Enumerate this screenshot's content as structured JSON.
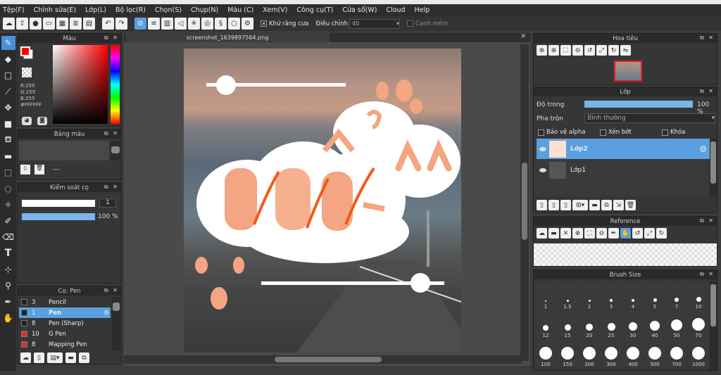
{
  "menu": [
    "Tệp(F)",
    "Chỉnh sửa(E)",
    "Lớp(L)",
    "Bộ lọc(R)",
    "Chọn(S)",
    "Chụp(N)",
    "Màu (C)",
    "Xem(V)",
    "Công cụ(T)",
    "Cửa sổ(W)",
    "Cloud",
    "Help"
  ],
  "toolbar": {
    "antialias_label": "Khử răng cưa",
    "adjust_label": "Điều chỉnh",
    "adjust_value": "40",
    "soft_edge_label": "Cạnh mềm"
  },
  "color_panel": {
    "title": "Màu",
    "r": "R:255",
    "g": "G:255",
    "b": "B:255",
    "hex": "#FFFFFF",
    "fg": "#ff0000",
    "bg": "#ffffff"
  },
  "palette_panel": {
    "title": "Bảng màu",
    "dash": "---"
  },
  "control_panel": {
    "title": "Kiểm soát cọ",
    "size": "1",
    "opacity": "100 %"
  },
  "brush_panel": {
    "title": "Cọ: Pen",
    "items": [
      {
        "size": "3",
        "name": "Pencil",
        "color": "#222222"
      },
      {
        "size": "1",
        "name": "Pen",
        "color": "#222222",
        "selected": true
      },
      {
        "size": "8",
        "name": "Pen (Sharp)",
        "color": "#222222"
      },
      {
        "size": "10",
        "name": "G Pen",
        "color": "#e03030"
      },
      {
        "size": "8",
        "name": "Mapping Pen",
        "color": "#e03030"
      }
    ]
  },
  "canvas": {
    "tab": "screenshot_1639897564.png"
  },
  "navigator": {
    "title": "Hoa tiêu"
  },
  "layer_panel": {
    "title": "Lớp",
    "opacity_label": "Độ trong",
    "opacity_value": "100 %",
    "blend_label": "Pha trộn",
    "blend_value": "Bình thường",
    "protect_alpha": "Bảo vệ alpha",
    "clipping": "Xén bớt",
    "lock": "Khóa",
    "layers": [
      {
        "name": "Lớp2",
        "selected": true
      },
      {
        "name": "Lớp1",
        "selected": false
      }
    ]
  },
  "reference_panel": {
    "title": "Reference"
  },
  "brush_size_panel": {
    "title": "Brush Size",
    "sizes": [
      "1",
      "1.5",
      "2",
      "3",
      "4",
      "5",
      "7",
      "10",
      "12",
      "15",
      "20",
      "25",
      "30",
      "40",
      "50",
      "70",
      "100",
      "150",
      "200",
      "300",
      "400",
      "500",
      "700",
      "1000"
    ]
  }
}
